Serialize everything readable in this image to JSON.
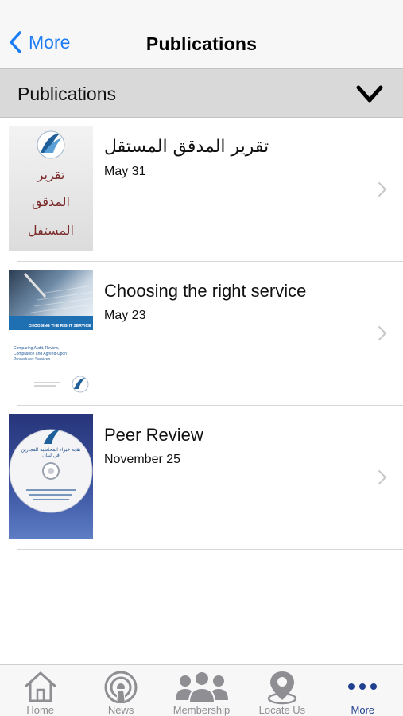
{
  "navbar": {
    "back_label": "More",
    "title": "Publications"
  },
  "section": {
    "title": "Publications"
  },
  "publications": [
    {
      "title": "تقرير المدقق المستقل",
      "date": "May 31",
      "cover_text": [
        "تقرير",
        "المدقق",
        "المستقل"
      ]
    },
    {
      "title": "Choosing the right service",
      "date": "May 23",
      "cover_band": "CHOOSING THE RIGHT SERVICE",
      "cover_text": "Comparing Audit, Review, Compilation and Agreed-Upon Procedures Services"
    },
    {
      "title": "Peer Review",
      "date": "November 25",
      "cover_text": "نقابة خبراء المحاسبة المجازين في لبنان"
    }
  ],
  "tabbar": {
    "tabs": [
      {
        "label": "Home",
        "icon": "home-icon"
      },
      {
        "label": "News",
        "icon": "broadcast-icon"
      },
      {
        "label": "Membership",
        "icon": "people-icon"
      },
      {
        "label": "Locate Us",
        "icon": "location-pin-icon"
      },
      {
        "label": "More",
        "icon": "more-dots-icon"
      }
    ],
    "active": "More"
  },
  "colors": {
    "accent": "#1b7cf5",
    "active_tab": "#1f3f8f",
    "inactive_tab": "#8e8e93",
    "section_bg": "#d9d9d9",
    "navbar_bg": "#f7f7f7"
  }
}
